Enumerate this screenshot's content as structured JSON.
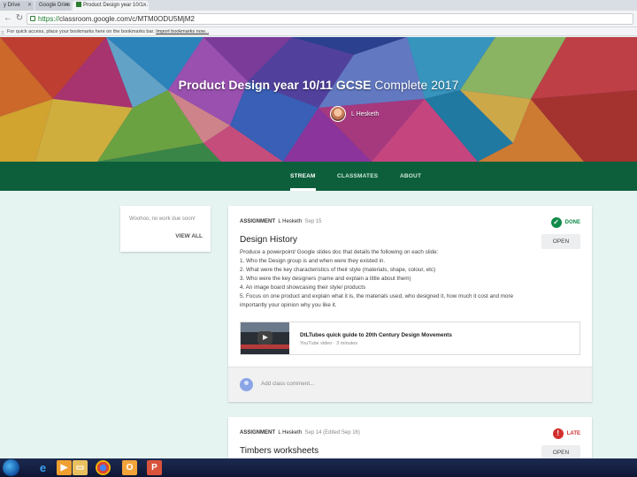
{
  "browser": {
    "tabs": [
      {
        "label": "y Drive"
      },
      {
        "label": "Google Drive"
      },
      {
        "label": "Product Design year 10/1…"
      }
    ],
    "ghost_tabs": [],
    "url_scheme": "https://",
    "url_rest": "classroom.google.com/c/MTM0ODU5MjM2",
    "bookmarks_text": "For quick access, place your bookmarks here on the bookmarks bar.",
    "bookmarks_link": "Import bookmarks now..."
  },
  "banner": {
    "title_bold": "Product Design year 10/11 GCSE",
    "title_rest": " Complete 2017",
    "teacher": "L Hesketh"
  },
  "classnav": {
    "tabs": [
      "STREAM",
      "CLASSMATES",
      "ABOUT"
    ]
  },
  "upcoming": {
    "text": "Woohoo, no work due soon!",
    "view_all": "VIEW ALL"
  },
  "posts": [
    {
      "label": "ASSIGNMENT",
      "author": "L Hesketh",
      "date": "Sep 15",
      "status": "DONE",
      "status_icon": "check-icon",
      "status_color": "#0f8a4a",
      "open": "OPEN",
      "title": "Design History",
      "body": [
        "Produce a powerpoint/ Google slides doc that details the following on each slide:",
        "1. Who the Design group is and when were they existed in.",
        "2. What were the key characteristics of their style (materials, shape, colour, etc)",
        "3. Who were the key designers (name and explain a little about them)",
        "4. An image board showcasing their style/ products",
        "5. Focus on one product and explain what it is, the materials used, who designed it, how much it cost and more",
        "importantly your opinion why you like it."
      ],
      "attachment_title": "DtLTubes quick guide to 20th Century Design Movements",
      "attachment_sub": "YouTube video · 3 minutes",
      "comment_placeholder": "Add class comment..."
    },
    {
      "label": "ASSIGNMENT",
      "author": "L Hesketh",
      "date": "Sep 14 (Edited Sep 16)",
      "status": "LATE",
      "status_icon": "alert-icon",
      "status_color": "#d32f2f",
      "open": "OPEN",
      "title": "Timbers worksheets"
    }
  ],
  "taskbar": {
    "icons": [
      "windows-start-icon",
      "internet-explorer-icon",
      "media-player-icon",
      "file-explorer-icon",
      "chrome-icon",
      "outlook-icon",
      "powerpoint-icon"
    ]
  },
  "colors": {
    "accent": "#0d5f3c",
    "page_bg": "#e6f4f1"
  }
}
